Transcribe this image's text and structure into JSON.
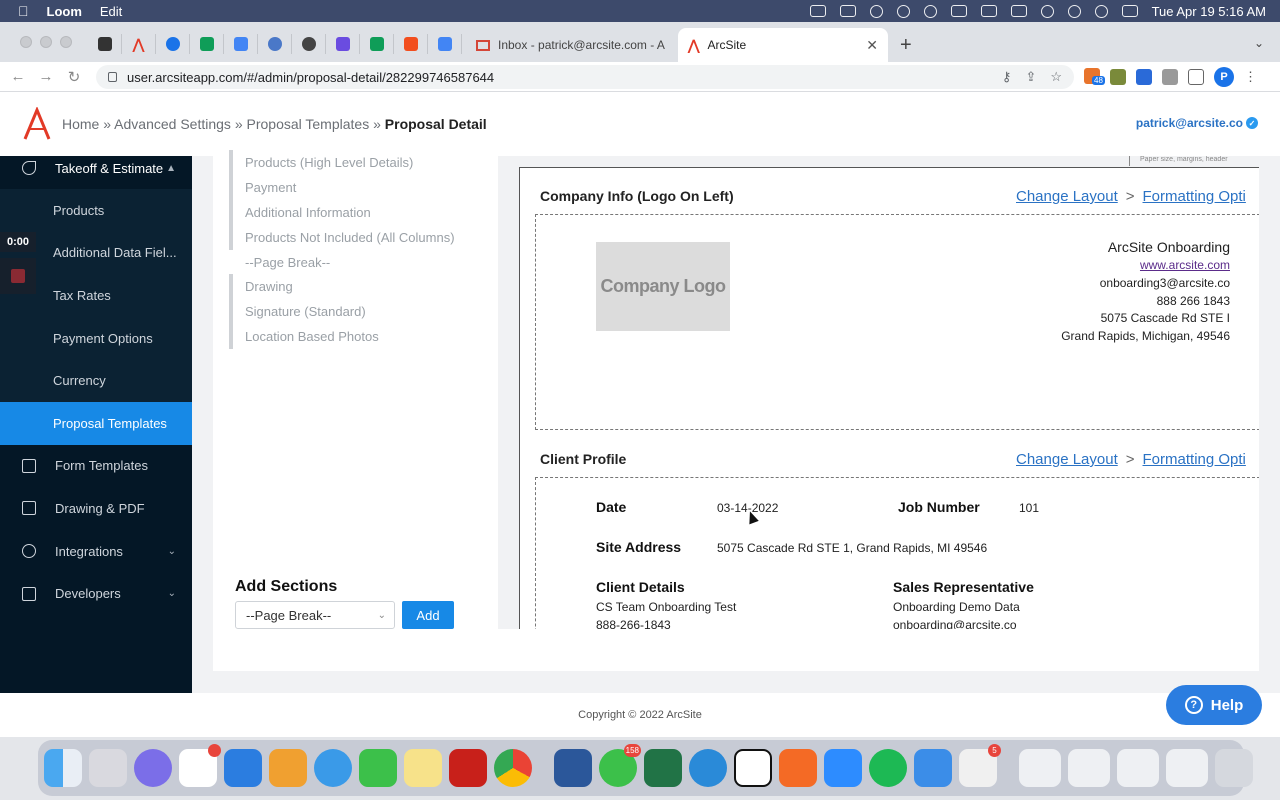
{
  "menubar": {
    "app_name": "Loom",
    "menu_edit": "Edit",
    "datetime": "Tue Apr 19  5:16 AM"
  },
  "tabs": {
    "inbox_label": "Inbox - patrick@arcsite.com - A",
    "active_label": "ArcSite"
  },
  "address": {
    "url": "user.arcsiteapp.com/#/admin/proposal-detail/282299746587644",
    "ext_badge": "48",
    "profile_initial": "P"
  },
  "header": {
    "crumbs": [
      "Home",
      "Advanced Settings",
      "Proposal Templates"
    ],
    "separator": "»",
    "current": "Proposal Detail",
    "user_email": "patrick@arcsite.co"
  },
  "loom": {
    "timer": "0:00"
  },
  "sidebar": {
    "takeoff_label": "Takeoff & Estimate",
    "sub_items": [
      "Products",
      "Additional Data Fiel...",
      "Tax Rates",
      "Payment Options",
      "Currency",
      "Proposal Templates"
    ],
    "items": [
      "Form Templates",
      "Drawing & PDF",
      "Integrations",
      "Developers"
    ]
  },
  "sections": {
    "list": [
      "Products (High Level Details)",
      "Payment",
      "Additional Information",
      "Products Not Included (All Columns)",
      "--Page Break--",
      "Drawing",
      "Signature (Standard)",
      "Location Based Photos"
    ],
    "add_title": "Add Sections",
    "select_value": "--Page Break--",
    "add_button": "Add"
  },
  "preview": {
    "paper_hint": "Paper size, margins, header",
    "change_layout": "Change Layout",
    "gt": ">",
    "formatting": "Formatting Opti",
    "company_block_title": "Company Info (Logo On Left)",
    "logo_text": "Company Logo",
    "company": {
      "name": "ArcSite Onboarding",
      "website": "www.arcsite.com",
      "email": "onboarding3@arcsite.co",
      "phone": "888 266 1843",
      "address1": "5075 Cascade Rd STE I",
      "address2": "Grand Rapids, Michigan, 49546"
    },
    "client_block_title": "Client Profile",
    "client": {
      "date_label": "Date",
      "date_value": "03-14-2022",
      "job_label": "Job Number",
      "job_value": "101",
      "site_label": "Site Address",
      "site_value": "5075 Cascade Rd STE 1, Grand Rapids, MI 49546",
      "details_label": "Client Details",
      "details_name": "CS Team Onboarding Test",
      "details_phone": "888-266-1843",
      "rep_label": "Sales Representative",
      "rep_name": "Onboarding Demo Data",
      "rep_email": "onboarding@arcsite.co"
    }
  },
  "footer": {
    "copyright": "Copyright © 2022 ArcSite",
    "help": "Help"
  },
  "dock": {
    "messages_badge": "158",
    "slack_badge": "",
    "tasks_badge": "5"
  }
}
